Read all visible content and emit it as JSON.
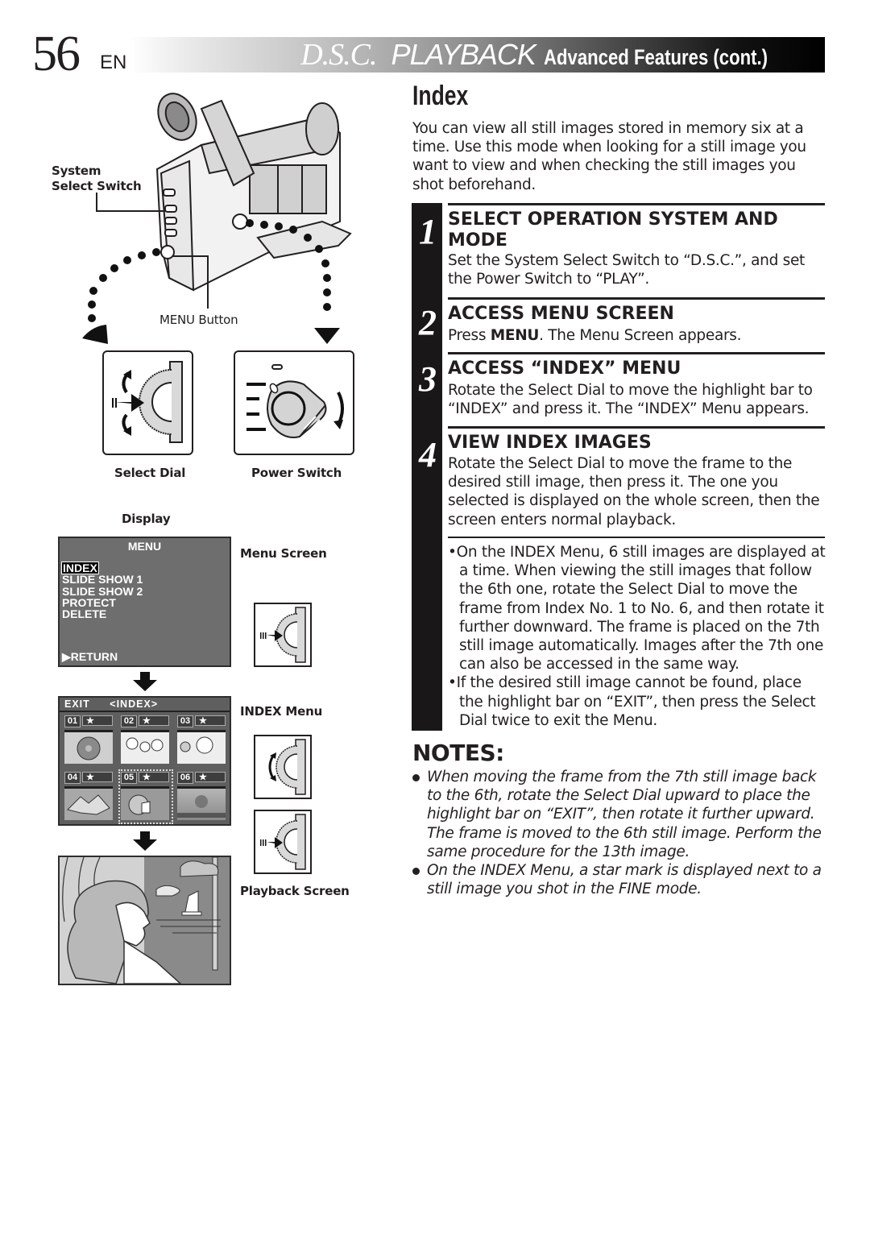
{
  "header": {
    "page_number": "56",
    "language": "EN",
    "title_dsc": "D.S.C.",
    "title_playback": "PLAYBACK",
    "title_advanced": "Advanced Features (cont.)"
  },
  "section": {
    "title": "Index",
    "intro": "You can view all still images stored in memory six at a time. Use this mode when looking for a still image you want to view and when checking the still images you shot beforehand."
  },
  "steps": [
    {
      "number": "1",
      "title_line1": "SELECT OPERATION SYSTEM AND",
      "title_line2": "MODE",
      "body": "Set the System Select Switch to “D.S.C.”, and set the Power Switch to “PLAY”."
    },
    {
      "number": "2",
      "title": "ACCESS MENU SCREEN",
      "body_pre": "Press ",
      "body_bold": "MENU",
      "body_post": ". The Menu Screen appears."
    },
    {
      "number": "3",
      "title": "ACCESS “INDEX” MENU",
      "body": "Rotate the Select Dial to move the highlight bar to “INDEX” and press it. The “INDEX” Menu appears."
    },
    {
      "number": "4",
      "title": "VIEW INDEX IMAGES",
      "body": "Rotate the Select Dial to move the frame to the desired still image, then press it. The one you selected is displayed on the whole screen, then the screen enters normal playback."
    }
  ],
  "step_bullets": [
    "•On the INDEX Menu, 6 still images are displayed at a time. When viewing the still images that follow the 6th one, rotate the Select Dial to move the frame from Index No. 1 to No. 6, and then rotate it further downward. The frame is placed on the 7th still image automatically. Images after the 7th one can also be accessed in the same way.",
    "•If the desired still image cannot be found, place the highlight bar on “EXIT”, then press the Select Dial twice to exit the Menu."
  ],
  "notes": {
    "title": "NOTES:",
    "items": [
      "When moving the frame from the 7th still image back to the 6th, rotate the Select Dial upward to place the highlight bar on “EXIT”, then rotate it further upward. The frame is moved to the 6th still image. Perform the same procedure for the 13th image.",
      "On the INDEX Menu, a star mark is displayed next to a still image you shot in the FINE mode."
    ]
  },
  "figure": {
    "label_system_select_line1": "System",
    "label_system_select_line2": "Select Switch",
    "label_menu_button": "MENU Button",
    "label_select_dial": "Select Dial",
    "label_power_switch": "Power Switch",
    "label_display": "Display",
    "label_menu_screen": "Menu Screen",
    "label_index_menu": "INDEX Menu",
    "label_playback_screen": "Playback Screen"
  },
  "menu_screen": {
    "title": "MENU",
    "items": [
      "INDEX",
      "SLIDE SHOW 1",
      "SLIDE SHOW 2",
      "PROTECT",
      "DELETE"
    ],
    "highlighted": "INDEX",
    "return_label": "▶RETURN"
  },
  "index_screen": {
    "exit_label": "EXIT",
    "title": "<INDEX>",
    "thumbnails": [
      {
        "num": "01",
        "star": "★",
        "subject": "flower"
      },
      {
        "num": "02",
        "star": "★",
        "subject": "people"
      },
      {
        "num": "03",
        "star": "★",
        "subject": "person"
      },
      {
        "num": "04",
        "star": "★",
        "subject": "mountain"
      },
      {
        "num": "05",
        "star": "★",
        "subject": "woman-window",
        "selected": true
      },
      {
        "num": "06",
        "star": "★",
        "subject": "sunset"
      }
    ]
  },
  "colors": {
    "text": "#231f20",
    "step_bar": "#1a1718",
    "menu_bg": "#6e6e6e",
    "index_bg": "#5f5f5f"
  }
}
